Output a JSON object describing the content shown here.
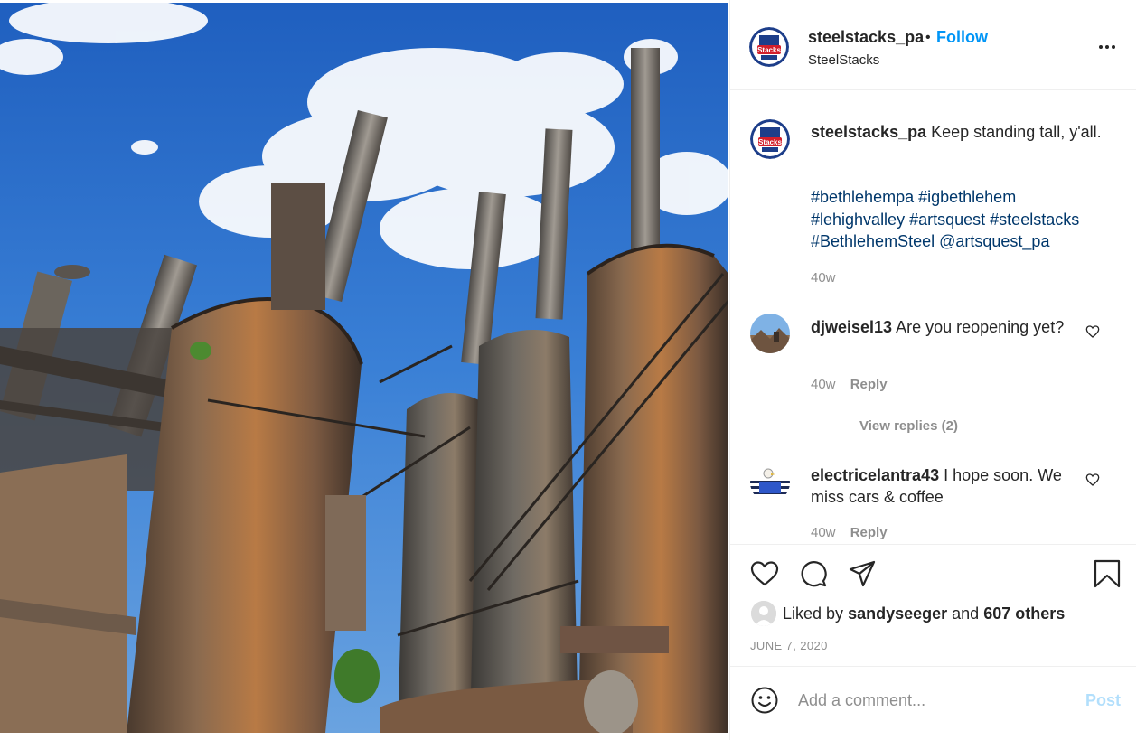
{
  "post": {
    "username": "steelstacks_pa",
    "follow_label": "Follow",
    "separator": "•",
    "location": "SteelStacks",
    "image_alt": "Rusted blast furnaces against a blue sky"
  },
  "caption": {
    "username": "steelstacks_pa",
    "text": "Keep standing tall, y'all.",
    "hashtags": [
      "#bethlehempa",
      "#igbethlehem",
      "#lehighvalley",
      "#artsquest",
      "#steelstacks",
      "#BethlehemSteel",
      "@artsquest_pa"
    ],
    "time": "40w"
  },
  "comments": [
    {
      "username": "djweisel13",
      "text": "Are you reopening yet?",
      "time": "40w",
      "reply_label": "Reply",
      "view_replies": "View replies (2)"
    },
    {
      "username": "electricelantra43",
      "text": "I hope soon. We miss cars & coffee",
      "time": "40w",
      "reply_label": "Reply"
    }
  ],
  "likes": {
    "prefix": "Liked by",
    "user": "sandyseeger",
    "conjunction": "and",
    "others": "607 others"
  },
  "date": "JUNE 7, 2020",
  "add_comment": {
    "placeholder": "Add a comment...",
    "post_label": "Post"
  },
  "colors": {
    "link_blue": "#0095f6",
    "hashtag_blue": "#00376b",
    "muted": "#8e8e8e",
    "post_disabled": "#b2dffc"
  }
}
